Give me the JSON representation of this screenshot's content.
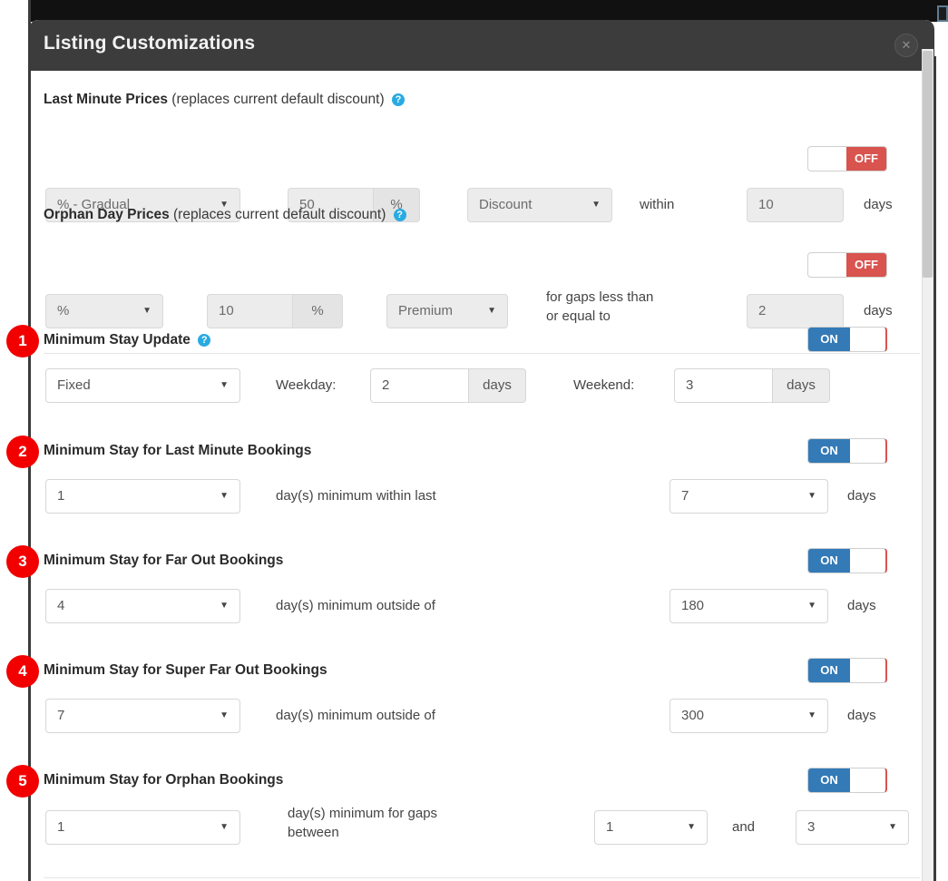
{
  "window": {
    "title": "Listing Customizations",
    "close_icon": "close-icon"
  },
  "colors": {
    "header_bg": "#3c3c3c",
    "toggle_on": "#337ab7",
    "toggle_off": "#d9534f",
    "badge": "#f20000",
    "help_icon": "#29abe2"
  },
  "sections": [
    {
      "id": "last-minute-prices",
      "title": "Last Minute Prices",
      "subtitle": "(replaces current default discount)",
      "has_help": true,
      "badge": null,
      "toggle": {
        "state": "OFF",
        "label": "OFF"
      },
      "enabled": false,
      "controls": {
        "mode_select": "% - Gradual",
        "amount_value": "50",
        "amount_suffix": "%",
        "type_select": "Discount",
        "mid_label": "within",
        "days_value": "10",
        "days_label": "days"
      }
    },
    {
      "id": "orphan-day-prices",
      "title": "Orphan Day Prices",
      "subtitle": "(replaces current default discount)",
      "has_help": true,
      "badge": null,
      "toggle": {
        "state": "OFF",
        "label": "OFF"
      },
      "enabled": false,
      "controls": {
        "mode_select": "%",
        "amount_value": "10",
        "amount_suffix": "%",
        "type_select": "Premium",
        "mid_label_line1": "for gaps less than",
        "mid_label_line2": "or equal to",
        "days_value": "2",
        "days_label": "days"
      }
    },
    {
      "id": "minimum-stay-update",
      "title": "Minimum Stay Update",
      "subtitle": "",
      "has_help": true,
      "badge": "1",
      "toggle": {
        "state": "ON",
        "label": "ON"
      },
      "enabled": true,
      "controls": {
        "mode_select": "Fixed",
        "weekday_label": "Weekday:",
        "weekday_value": "2",
        "weekday_suffix": "days",
        "weekend_label": "Weekend:",
        "weekend_value": "3",
        "weekend_suffix": "days"
      }
    },
    {
      "id": "minimum-stay-last-minute",
      "title": "Minimum Stay for Last Minute Bookings",
      "subtitle": "",
      "has_help": false,
      "badge": "2",
      "toggle": {
        "state": "ON",
        "label": "ON"
      },
      "enabled": true,
      "controls": {
        "days_min_select": "1",
        "mid_label": "day(s) minimum within last",
        "window_select": "7",
        "days_label": "days"
      }
    },
    {
      "id": "minimum-stay-far-out",
      "title": "Minimum Stay for Far Out Bookings",
      "subtitle": "",
      "has_help": false,
      "badge": "3",
      "toggle": {
        "state": "ON",
        "label": "ON"
      },
      "enabled": true,
      "controls": {
        "days_min_select": "4",
        "mid_label": "day(s) minimum outside of",
        "window_select": "180",
        "days_label": "days"
      }
    },
    {
      "id": "minimum-stay-super-far-out",
      "title": "Minimum Stay for Super Far Out Bookings",
      "subtitle": "",
      "has_help": false,
      "badge": "4",
      "toggle": {
        "state": "ON",
        "label": "ON"
      },
      "enabled": true,
      "controls": {
        "days_min_select": "7",
        "mid_label": "day(s) minimum outside of",
        "window_select": "300",
        "days_label": "days"
      }
    },
    {
      "id": "minimum-stay-orphan",
      "title": "Minimum Stay for Orphan Bookings",
      "subtitle": "",
      "has_help": false,
      "badge": "5",
      "toggle": {
        "state": "ON",
        "label": "ON"
      },
      "enabled": true,
      "controls": {
        "days_min_select": "1",
        "mid_label_line1": "day(s) minimum for gaps",
        "mid_label_line2": "between",
        "gap_from_select": "1",
        "and_label": "and",
        "gap_to_select": "3"
      }
    }
  ],
  "help_glyph": "?",
  "caret_glyph": "▼",
  "close_glyph": "✕"
}
